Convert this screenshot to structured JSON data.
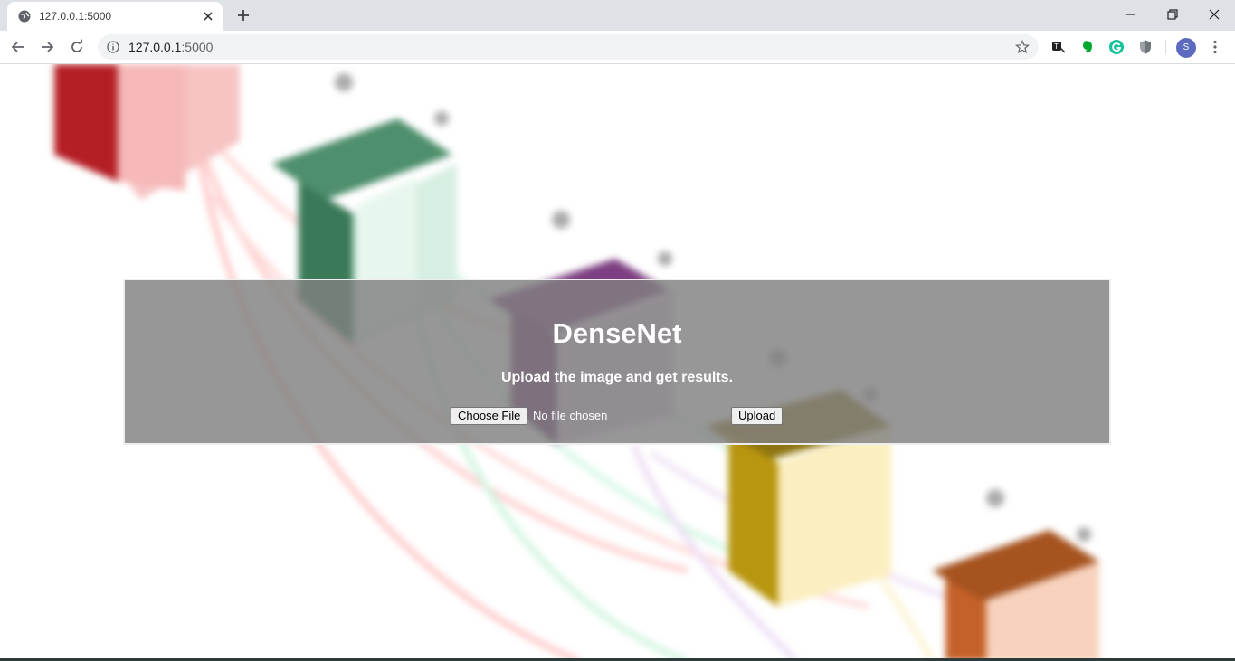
{
  "browser": {
    "tab_title": "127.0.0.1:5000",
    "url_host": "127.0.0.1",
    "url_port": ":5000",
    "profile_initial": "S"
  },
  "page": {
    "heading": "DenseNet",
    "subheading": "Upload the image and get results.",
    "choose_file_label": "Choose File",
    "file_status": "No file chosen",
    "upload_label": "Upload"
  },
  "colors": {
    "panel": "#808080",
    "block_red": "#c0262d",
    "block_green": "#3e8a62",
    "block_purple": "#7b3f7a",
    "block_gold": "#b8960f",
    "block_orange": "#c4612a"
  }
}
